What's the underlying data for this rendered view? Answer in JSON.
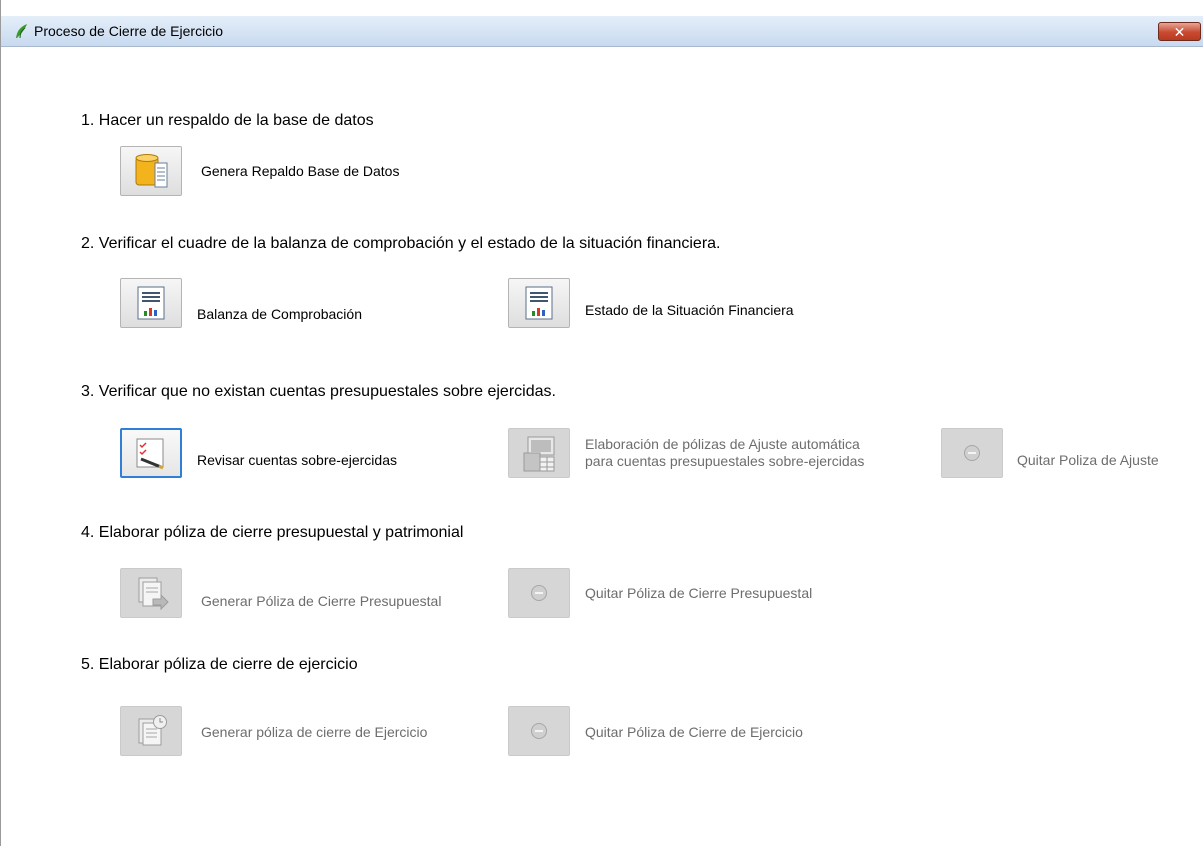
{
  "window": {
    "title": "Proceso de Cierre de Ejercicio",
    "close_glyph": "✕"
  },
  "steps": {
    "s1": {
      "title": "1.  Hacer un respaldo de la base de datos",
      "backup_label": "Genera Repaldo Base de Datos"
    },
    "s2": {
      "title": "2.  Verificar el cuadre de la balanza de comprobación y el estado de la situación financiera.",
      "balanza_label": "Balanza de Comprobación",
      "estado_label": "Estado de la Situación Financiera"
    },
    "s3": {
      "title": "3.  Verificar que no existan cuentas presupuestales sobre ejercidas.",
      "revisar_label": "Revisar cuentas sobre-ejercidas",
      "elaboracion_line1": "Elaboración de pólizas de Ajuste automática",
      "elaboracion_line2": "para cuentas presupuestales sobre-ejercidas",
      "quitar_ajuste_label": "Quitar Poliza de Ajuste"
    },
    "s4": {
      "title": "4. Elaborar póliza de cierre presupuestal y patrimonial",
      "generar_label": "Generar Póliza de Cierre Presupuestal",
      "quitar_label": "Quitar Póliza de Cierre Presupuestal"
    },
    "s5": {
      "title": "5. Elaborar póliza de cierre de ejercicio",
      "generar_label": "Generar póliza de cierre de Ejercicio",
      "quitar_label": "Quitar Póliza de Cierre de Ejercicio"
    }
  },
  "colors": {
    "title_bg": "#c8daf0",
    "close_red": "#c84a30",
    "focus_blue": "#2f7fd6",
    "disabled_text": "#6d6d6d"
  },
  "icons": [
    "app-leaf-icon",
    "database-icon",
    "report-chart-icon",
    "checklist-pencil-icon",
    "computer-table-icon",
    "minus-circle-icon",
    "document-arrow-icon",
    "document-clock-icon"
  ]
}
